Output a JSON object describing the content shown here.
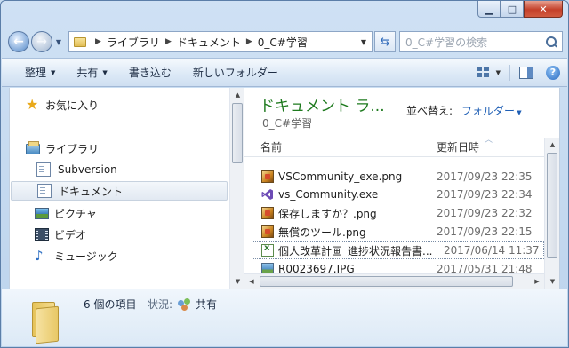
{
  "window": {
    "minimize_icon": "minimize-icon",
    "maximize_icon": "maximize-icon",
    "close_icon": "close-icon"
  },
  "address_bar": {
    "breadcrumbs": [
      "ライブラリ",
      "ドキュメント",
      "0_C#学習"
    ],
    "separator": "▶",
    "search_placeholder": "0_C#学習の検索"
  },
  "toolbar": {
    "organize": "整理",
    "share": "共有",
    "burn": "書き込む",
    "new_folder": "新しいフォルダー"
  },
  "nav_pane": {
    "favorites": "お気に入り",
    "libraries": "ライブラリ",
    "items": [
      {
        "label": "Subversion",
        "icon": "document-library-icon"
      },
      {
        "label": "ドキュメント",
        "icon": "document-library-icon",
        "selected": true
      },
      {
        "label": "ピクチャ",
        "icon": "pictures-library-icon"
      },
      {
        "label": "ビデオ",
        "icon": "video-library-icon"
      },
      {
        "label": "ミュージック",
        "icon": "music-library-icon"
      }
    ]
  },
  "library_header": {
    "title": "ドキュメント ラ...",
    "subtitle": "0_C#学習",
    "arrange_label": "並べ替え:",
    "arrange_value": "フォルダー"
  },
  "columns": {
    "name": "名前",
    "date": "更新日時"
  },
  "files": [
    {
      "name": "VSCommunity_exe.png",
      "date": "2017/09/23 22:35",
      "icon": "png-file-icon"
    },
    {
      "name": "vs_Community.exe",
      "date": "2017/09/23 22:34",
      "icon": "visual-studio-icon"
    },
    {
      "name": "保存しますか？.png",
      "date": "2017/09/23 22:32",
      "icon": "png-file-icon"
    },
    {
      "name": "無償のツール.png",
      "date": "2017/09/23 22:15",
      "icon": "png-file-icon"
    },
    {
      "name": "個人改革計画_進捗状況報告書...",
      "date": "2017/06/14 11:37",
      "icon": "excel-file-icon"
    },
    {
      "name": "R0023697.JPG",
      "date": "2017/05/31 21:48",
      "icon": "jpg-file-icon"
    }
  ],
  "details": {
    "item_count": "6 個の項目",
    "status_label": "状況:",
    "status_value": "共有"
  }
}
